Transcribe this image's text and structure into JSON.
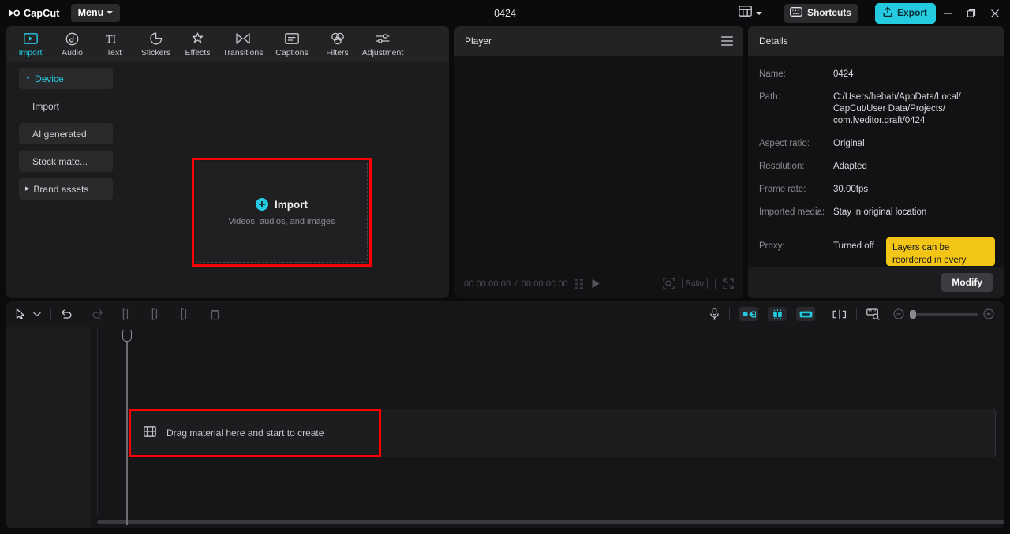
{
  "titlebar": {
    "brand": "CapCut",
    "menu_label": "Menu",
    "project_title": "0424",
    "shortcuts_label": "Shortcuts",
    "export_label": "Export",
    "accent_color": "#24cbe0"
  },
  "media_panel": {
    "tabs": [
      {
        "label": "Import",
        "icon": "import-icon",
        "active": true
      },
      {
        "label": "Audio",
        "icon": "audio-icon",
        "active": false
      },
      {
        "label": "Text",
        "icon": "text-icon",
        "active": false
      },
      {
        "label": "Stickers",
        "icon": "stickers-icon",
        "active": false
      },
      {
        "label": "Effects",
        "icon": "effects-icon",
        "active": false
      },
      {
        "label": "Transitions",
        "icon": "transitions-icon",
        "active": false
      },
      {
        "label": "Captions",
        "icon": "captions-icon",
        "active": false
      },
      {
        "label": "Filters",
        "icon": "filters-icon",
        "active": false
      },
      {
        "label": "Adjustment",
        "icon": "adjustment-icon",
        "active": false
      }
    ],
    "side_items": [
      {
        "label": "Device",
        "active": true,
        "expandable": true
      },
      {
        "label": "Import",
        "active": false,
        "expandable": false
      },
      {
        "label": "AI generated",
        "active": false,
        "expandable": false
      },
      {
        "label": "Stock mate...",
        "active": false,
        "expandable": false
      },
      {
        "label": "Brand assets",
        "active": false,
        "expandable": true
      }
    ],
    "import_box": {
      "title": "Import",
      "subtitle": "Videos, audios, and images"
    }
  },
  "player": {
    "title": "Player",
    "current_time": "00:00:00:00",
    "total_time": "00:00:00:00",
    "time_separator": "/",
    "ratio_label": "Ratio"
  },
  "details": {
    "title": "Details",
    "rows": [
      {
        "label": "Name:",
        "value": "0424"
      },
      {
        "label": "Path:",
        "value": "C:/Users/hebah/AppData/Local/CapCut/User Data/Projects/com.lveditor.draft/0424",
        "value_lines": [
          "C:/Users/hebah/AppData/Local/",
          "CapCut/User Data/Projects/",
          "com.lveditor.draft/0424"
        ]
      },
      {
        "label": "Aspect ratio:",
        "value": "Original"
      },
      {
        "label": "Resolution:",
        "value": "Adapted"
      },
      {
        "label": "Frame rate:",
        "value": "30.00fps"
      },
      {
        "label": "Imported media:",
        "value": "Stay in original location"
      },
      {
        "label": "Proxy:",
        "value": "Turned off"
      }
    ],
    "modify_label": "Modify",
    "tooltip": {
      "text": "Layers can be reordered in every",
      "background": "#f2c517"
    }
  },
  "timeline": {
    "toolbar_left": [
      {
        "icon": "select-tool-icon"
      },
      {
        "icon": "chevron-down-icon"
      },
      {
        "icon": "undo-icon"
      },
      {
        "icon": "redo-icon"
      },
      {
        "icon": "split-icon"
      },
      {
        "icon": "trim-start-icon"
      },
      {
        "icon": "trim-end-icon"
      },
      {
        "icon": "delete-icon"
      }
    ],
    "toolbar_right": [
      {
        "icon": "microphone-icon"
      },
      {
        "icon": "mirror-icon"
      },
      {
        "icon": "auto-cut-icon"
      },
      {
        "icon": "link-icon"
      },
      {
        "icon": "split-track-icon"
      },
      {
        "icon": "ruler-icon"
      },
      {
        "icon": "zoom-out-icon"
      },
      {
        "icon": "zoom-slider"
      },
      {
        "icon": "zoom-in-icon"
      }
    ],
    "dropzone_text": "Drag material here and start to create",
    "highlight_color": "#fe0000"
  }
}
